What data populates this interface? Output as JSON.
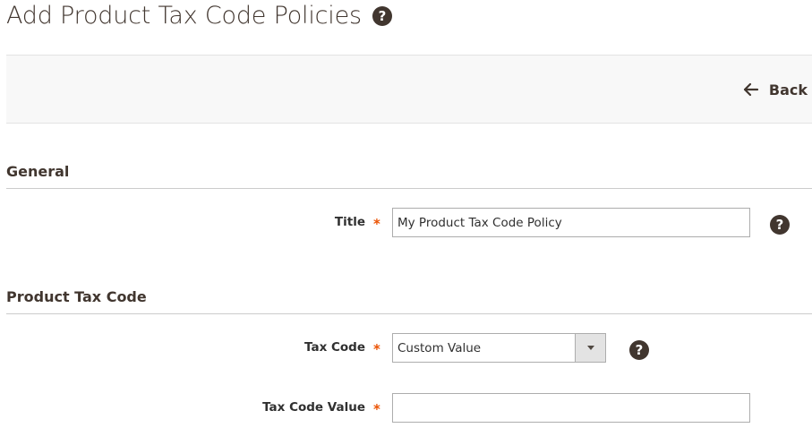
{
  "page": {
    "title": "Add Product Tax Code Policies",
    "help_icon": "question-circle-icon"
  },
  "action_bar": {
    "back_label": "Back",
    "back_icon": "arrow-left-icon"
  },
  "sections": {
    "general": {
      "title": "General",
      "fields": {
        "title": {
          "label": "Title",
          "required_mark": "*",
          "value": "My Product Tax Code Policy",
          "help_icon": "question-circle-icon"
        }
      }
    },
    "product_tax_code": {
      "title": "Product Tax Code",
      "fields": {
        "tax_code": {
          "label": "Tax Code",
          "required_mark": "*",
          "selected": "Custom Value",
          "help_icon": "question-circle-icon"
        },
        "tax_code_value": {
          "label": "Tax Code Value",
          "required_mark": "*",
          "value": ""
        }
      }
    }
  },
  "colors": {
    "title_text": "#41362f",
    "required": "#eb5202",
    "action_bar_bg": "#f8f8f8",
    "border": "#adadad"
  }
}
